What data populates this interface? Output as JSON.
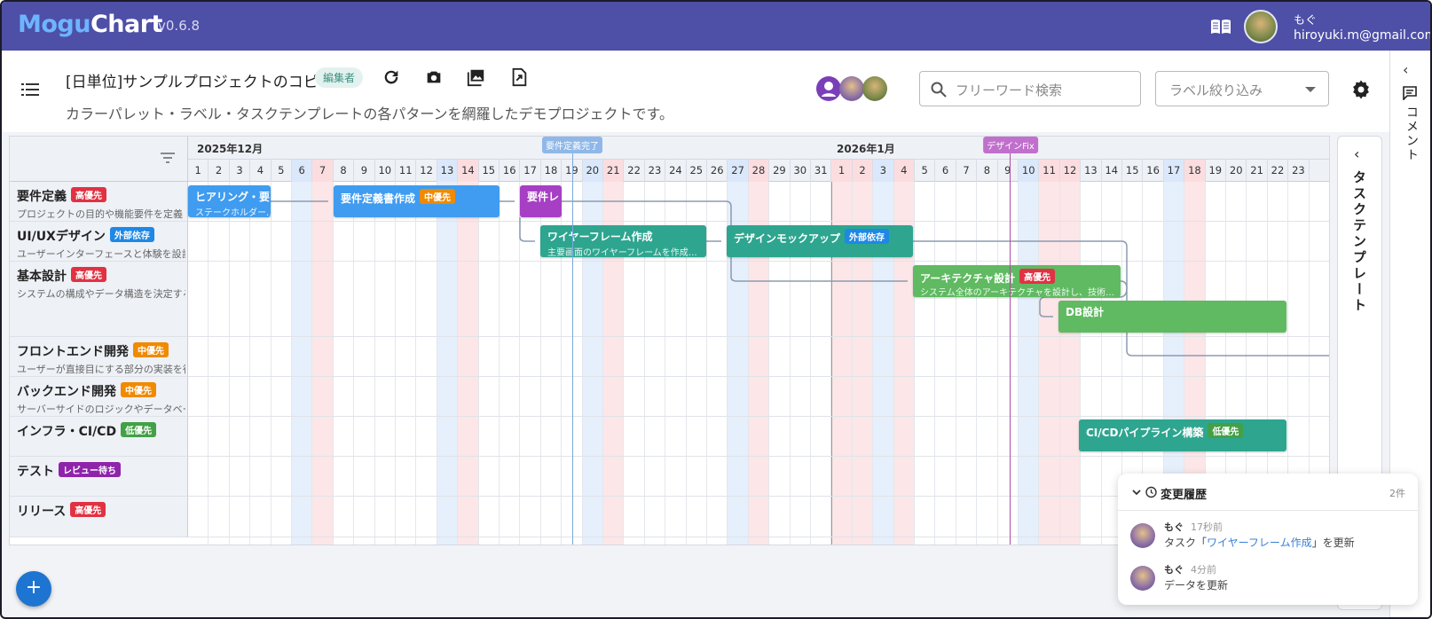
{
  "app": {
    "logo_part1": "Mogu",
    "logo_part2": "Chart",
    "version": "v0.6.8"
  },
  "user": {
    "name": "もぐ",
    "email": "hiroyuki.m@gmail.com"
  },
  "project": {
    "title": "[日単位]サンプルプロジェクトのコピー",
    "role_badge": "編集者",
    "description": "カラーパレット・ラベル・タスクテンプレートの各パターンを網羅したデモプロジェクトです。"
  },
  "toolbar": {
    "search_placeholder": "フリーワード検索",
    "label_filter_placeholder": "ラベル絞り込み"
  },
  "comment_panel": {
    "label": "コメント"
  },
  "template_panel": {
    "label": "タスクテンプレート"
  },
  "months": [
    {
      "label": "2025年12月"
    },
    {
      "label": "2026年1月"
    }
  ],
  "colors": {
    "header": "#4e4fa7",
    "blue_task": "#3f9cf0",
    "purple_task": "#a63fc4",
    "teal_task": "#2ea58f",
    "green_task": "#5fba61",
    "high": "#e03243",
    "mid": "#f08a00",
    "low": "#43a047",
    "external": "#1e88e5",
    "review": "#8e24aa"
  },
  "categories": [
    {
      "name": "要件定義",
      "tag": "高優先",
      "tag_color": "#e03243",
      "desc": "プロジェクトの目的や機能要件を定義"
    },
    {
      "name": "UI/UXデザイン",
      "tag": "外部依存",
      "tag_color": "#1e88e5",
      "desc": "ユーザーインターフェースと体験を設計"
    },
    {
      "name": "基本設計",
      "tag": "高優先",
      "tag_color": "#e03243",
      "desc": "システムの構成やデータ構造を決定する"
    },
    {
      "name": "フロントエンド開発",
      "tag": "中優先",
      "tag_color": "#f08a00",
      "desc": "ユーザーが直接目にする部分の実装を行う"
    },
    {
      "name": "バックエンド開発",
      "tag": "中優先",
      "tag_color": "#f08a00",
      "desc": "サーバーサイドのロジックやデータベース"
    },
    {
      "name": "インフラ・CI/CD",
      "tag": "低優先",
      "tag_color": "#43a047",
      "desc": ""
    },
    {
      "name": "テスト",
      "tag": "レビュー待ち",
      "tag_color": "#8e24aa",
      "desc": ""
    },
    {
      "name": "リリース",
      "tag": "高優先",
      "tag_color": "#e03243",
      "desc": ""
    }
  ],
  "tasks": [
    {
      "title": "ヒアリング・要",
      "sub": "ステークホルダー…",
      "color": "#3f9cf0",
      "tag": "",
      "tag_color": ""
    },
    {
      "title": "要件定義書作成",
      "sub": "",
      "color": "#3f9cf0",
      "tag": "中優先",
      "tag_color": "#f08a00"
    },
    {
      "title": "要件レ",
      "sub": "",
      "color": "#a63fc4",
      "tag": "",
      "tag_color": ""
    },
    {
      "title": "ワイヤーフレーム作成",
      "sub": "主要画面のワイヤーフレームを作成…",
      "color": "#2ea58f",
      "tag": "",
      "tag_color": ""
    },
    {
      "title": "デザインモックアップ",
      "sub": "",
      "color": "#2ea58f",
      "tag": "外部依存",
      "tag_color": "#1e88e5"
    },
    {
      "title": "アーキテクチャ設計",
      "sub": "システム全体のアーキテクチャを設計し、技術…",
      "color": "#5fba61",
      "tag": "高優先",
      "tag_color": "#e03243"
    },
    {
      "title": "DB設計",
      "sub": "",
      "color": "#5fba61",
      "tag": "",
      "tag_color": ""
    },
    {
      "title": "CI/CDパイプライン構築",
      "sub": "",
      "color": "#2ea58f",
      "tag": "低優先",
      "tag_color": "#43a047"
    }
  ],
  "milestones": [
    {
      "label": "要件定義完了",
      "color": "#8fb8e8"
    },
    {
      "label": "デザインFix",
      "color": "#c070cc"
    }
  ],
  "history": {
    "title": "変更履歴",
    "count": "2件",
    "entries": [
      {
        "user": "もぐ",
        "time": "17秒前",
        "prefix": "タスク「",
        "link": "ワイヤーフレーム作成",
        "suffix": "」を更新"
      },
      {
        "user": "もぐ",
        "time": "4分前",
        "prefix": "",
        "link": "",
        "suffix": "データを更新"
      }
    ]
  },
  "fab_label": "+"
}
